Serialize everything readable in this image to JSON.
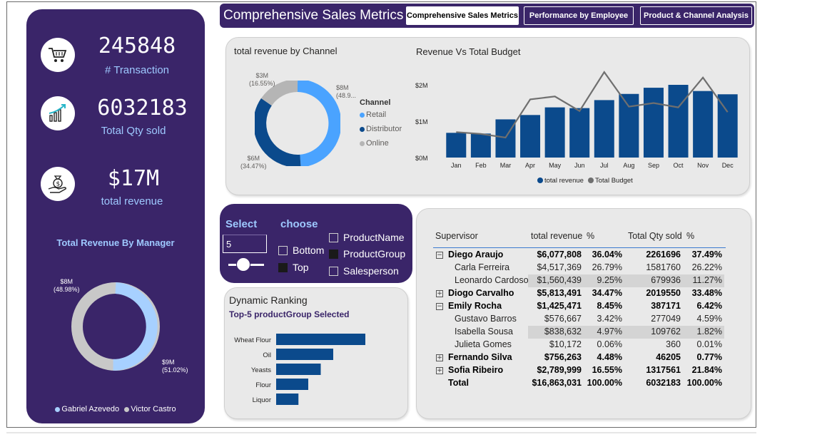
{
  "header": {
    "title": "Comprehensive Sales Metrics",
    "tabs": [
      {
        "label": "Comprehensive Sales Metrics",
        "active": true
      },
      {
        "label": "Performance by Employee",
        "active": false
      },
      {
        "label": "Product & Channel Analysis",
        "active": false
      }
    ]
  },
  "kpis": [
    {
      "icon": "shopping-cart-icon",
      "value": "245848",
      "label": "# Transaction"
    },
    {
      "icon": "growth-chart-icon",
      "value": "6032183",
      "label": "Total Qty sold"
    },
    {
      "icon": "money-bag-hand-icon",
      "value": "$17M",
      "label": "total revenue"
    }
  ],
  "manager_chart": {
    "title": "Total Revenue By Manager",
    "label_top": [
      "$8M",
      "(48.98%)"
    ],
    "label_bottom": [
      "$9M",
      "(51.02%)"
    ],
    "legend": [
      "Gabriel Azevedo",
      "Victor Castro"
    ],
    "colors": {
      "Gabriel Azevedo": "#a7d0ff",
      "Victor Castro": "#c8c8c8"
    }
  },
  "channel_chart": {
    "title": "total revenue by Channel",
    "legend_title": "Channel",
    "legend": [
      "Retail",
      "Distributor",
      "Online"
    ],
    "labels": {
      "retail": [
        "$8M",
        "(48.9..."
      ],
      "distributor": [
        "$6M",
        "(34.47%)"
      ],
      "online": [
        "$3M",
        "(16.55%)"
      ]
    },
    "colors": {
      "Retail": "#4aa3ff",
      "Distributor": "#0b4a8c",
      "Online": "#b5b5b5"
    }
  },
  "budget_chart": {
    "title": "Revenue Vs Total Budget",
    "y_ticks": [
      "$0M",
      "$1M",
      "$2M"
    ],
    "legend": [
      "total revenue",
      "Total Budget"
    ],
    "colors": {
      "total revenue": "#0b4a8c",
      "Total Budget": "#6f6f6f"
    }
  },
  "chart_data": [
    {
      "type": "pie",
      "title": "Total Revenue By Manager",
      "categories": [
        "Gabriel Azevedo",
        "Victor Castro"
      ],
      "values": [
        51.02,
        48.98
      ]
    },
    {
      "type": "pie",
      "title": "total revenue by Channel",
      "categories": [
        "Retail",
        "Distributor",
        "Online"
      ],
      "values": [
        48.98,
        34.47,
        16.55
      ]
    },
    {
      "type": "bar",
      "title": "Revenue Vs Total Budget",
      "categories": [
        "Jan",
        "Feb",
        "Mar",
        "Apr",
        "May",
        "Jun",
        "Jul",
        "Aug",
        "Sep",
        "Oct",
        "Nov",
        "Dec"
      ],
      "series": [
        {
          "name": "total revenue",
          "values": [
            0.68,
            0.66,
            1.05,
            1.17,
            1.38,
            1.36,
            1.58,
            1.75,
            1.92,
            2.0,
            1.83,
            1.74
          ]
        },
        {
          "name": "Total Budget",
          "values": [
            0.7,
            0.65,
            0.55,
            1.6,
            1.68,
            1.28,
            2.35,
            1.4,
            1.5,
            1.38,
            2.2,
            1.25
          ]
        }
      ],
      "ylim": [
        0,
        2.4
      ],
      "y_unit": "$M"
    },
    {
      "type": "bar",
      "title": "Top-5 productGroup Selected",
      "categories": [
        "Wheat Flour",
        "Oil",
        "Yeasts",
        "Flour",
        "Liquor"
      ],
      "values": [
        100,
        64,
        50,
        36,
        25
      ]
    }
  ],
  "select_panel": {
    "select_label": "Select",
    "choose_label": "choose",
    "input_value": "5",
    "direction_options": [
      {
        "label": "Bottom",
        "checked": false
      },
      {
        "label": "Top",
        "checked": true
      }
    ],
    "field_options": [
      {
        "label": "ProductName",
        "checked": false
      },
      {
        "label": "ProductGroup",
        "checked": true
      },
      {
        "label": "Salesperson",
        "checked": false
      }
    ]
  },
  "ranking": {
    "title": "Dynamic Ranking",
    "subtitle": "Top-5 productGroup Selected"
  },
  "table": {
    "headers": [
      "Supervisor",
      "total revenue",
      "%",
      "Total Qty sold",
      "%"
    ],
    "rows": [
      {
        "level": 0,
        "expander": "⊟",
        "name": "Diego Araujo",
        "revenue": "$6,077,808",
        "pct": "36.04%",
        "qty": "2261696",
        "qpct": "37.49%"
      },
      {
        "level": 1,
        "expander": "",
        "name": "Carla Ferreira",
        "revenue": "$4,517,369",
        "pct": "26.79%",
        "qty": "1581760",
        "qpct": "26.22%"
      },
      {
        "level": 1,
        "expander": "",
        "name": "Leonardo Cardoso",
        "revenue": "$1,560,439",
        "pct": "9.25%",
        "qty": "679936",
        "qpct": "11.27%"
      },
      {
        "level": 0,
        "expander": "⊞",
        "name": "Diogo Carvalho",
        "revenue": "$5,813,491",
        "pct": "34.47%",
        "qty": "2019550",
        "qpct": "33.48%"
      },
      {
        "level": 0,
        "expander": "⊟",
        "name": "Emily Rocha",
        "revenue": "$1,425,471",
        "pct": "8.45%",
        "qty": "387171",
        "qpct": "6.42%"
      },
      {
        "level": 1,
        "expander": "",
        "name": "Gustavo Barros",
        "revenue": "$576,667",
        "pct": "3.42%",
        "qty": "277049",
        "qpct": "4.59%"
      },
      {
        "level": 1,
        "expander": "",
        "name": "Isabella Sousa",
        "revenue": "$838,632",
        "pct": "4.97%",
        "qty": "109762",
        "qpct": "1.82%"
      },
      {
        "level": 1,
        "expander": "",
        "name": "Julieta Gomes",
        "revenue": "$10,172",
        "pct": "0.06%",
        "qty": "360",
        "qpct": "0.01%"
      },
      {
        "level": 0,
        "expander": "⊞",
        "name": "Fernando Silva",
        "revenue": "$756,263",
        "pct": "4.48%",
        "qty": "46205",
        "qpct": "0.77%"
      },
      {
        "level": 0,
        "expander": "⊞",
        "name": "Sofia Ribeiro",
        "revenue": "$2,789,999",
        "pct": "16.55%",
        "qty": "1317561",
        "qpct": "21.84%"
      },
      {
        "level": 0,
        "expander": "",
        "name": "Total",
        "revenue": "$16,863,031",
        "pct": "100.00%",
        "qty": "6032183",
        "qpct": "100.00%"
      }
    ]
  }
}
